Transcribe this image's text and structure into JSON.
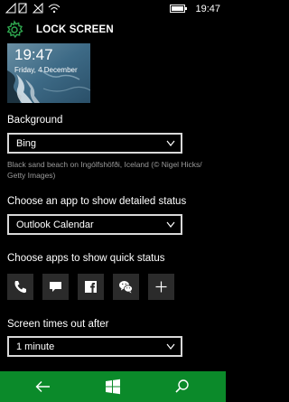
{
  "status_bar": {
    "time": "19:47",
    "icons": [
      "signal-icon",
      "no-sim-icon",
      "signal-off-icon",
      "wifi-icon",
      "battery-icon"
    ]
  },
  "header": {
    "title": "LOCK SCREEN",
    "icon": "gear-icon"
  },
  "preview": {
    "time": "19:47",
    "date": "Friday, 4 December"
  },
  "background": {
    "label": "Background",
    "selected": "Bing",
    "caption": "Black sand beach on Ingólfshöfði, Iceland (© Nigel Hicks/ Getty Images)"
  },
  "detailed_status": {
    "label": "Choose an app to show detailed status",
    "selected": "Outlook Calendar"
  },
  "quick_status": {
    "label": "Choose apps to show quick status",
    "apps": [
      "phone-icon",
      "messaging-icon",
      "facebook-icon",
      "wechat-icon",
      "add-icon"
    ]
  },
  "timeout": {
    "label": "Screen times out after",
    "selected": "1 minute"
  },
  "nav": {
    "buttons": [
      "back-icon",
      "start-icon",
      "search-icon"
    ]
  },
  "colors": {
    "accent": "#0b8a2a",
    "gear": "#2fa84f",
    "background": "#000000",
    "tile": "#2b2b2b",
    "caption": "#9a9a9a"
  }
}
